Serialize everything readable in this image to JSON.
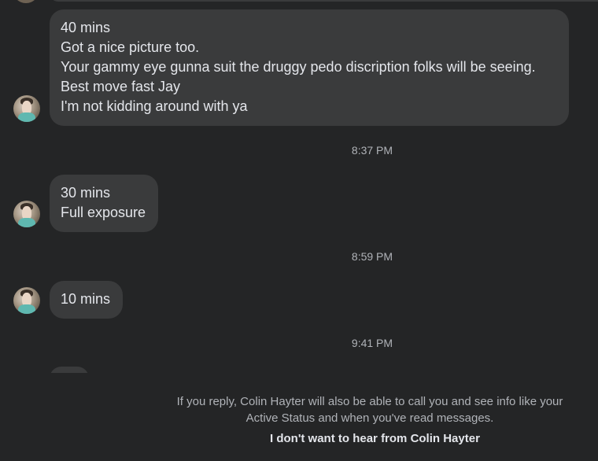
{
  "messages": [
    {
      "lines": [
        "40 mins",
        "Got a nice picture too.",
        "Your gammy eye gunna suit the druggy pedo discription folks will be seeing.",
        "Best move fast Jay",
        "I'm not kidding around with ya"
      ]
    },
    {
      "lines": [
        "30 mins",
        "Full exposure"
      ]
    },
    {
      "lines": [
        "10 mins"
      ]
    }
  ],
  "timestamps": [
    "8:37 PM",
    "8:59 PM",
    "9:41 PM"
  ],
  "footer": {
    "notice_lines": [
      "If you reply, Colin Hayter will also be able to call you and see info like your",
      "Active Status and when you've read messages."
    ],
    "block_link": "I don't want to hear from Colin Hayter"
  },
  "colors": {
    "background": "#242526",
    "bubble": "#3a3b3c",
    "text_primary": "#e4e6eb",
    "text_secondary": "#b0b3b8"
  }
}
